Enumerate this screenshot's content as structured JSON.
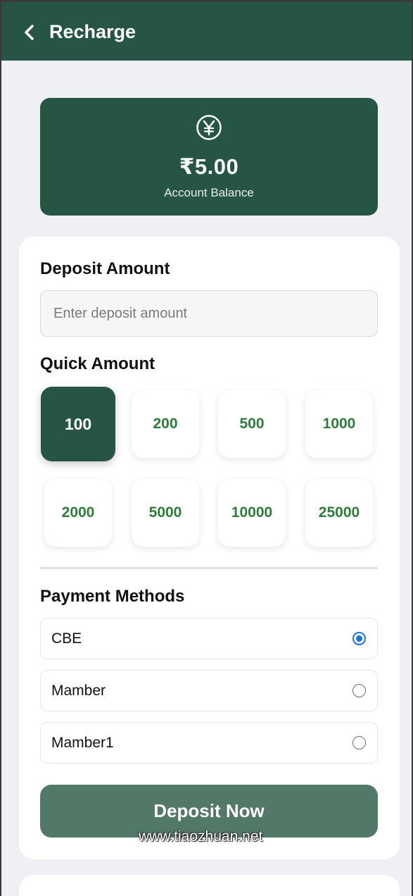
{
  "header": {
    "title": "Recharge",
    "back_icon": "chevron-left-icon"
  },
  "balance": {
    "icon": "yen-circle-icon",
    "amount": "₹5.00",
    "label": "Account Balance"
  },
  "deposit": {
    "title": "Deposit Amount",
    "placeholder": "Enter deposit amount",
    "value": ""
  },
  "quick": {
    "title": "Quick Amount",
    "amounts": [
      "100",
      "200",
      "500",
      "1000",
      "2000",
      "5000",
      "10000",
      "25000"
    ],
    "selected": "100"
  },
  "payment": {
    "title": "Payment Methods",
    "methods": [
      {
        "label": "CBE",
        "checked": true
      },
      {
        "label": "Mamber",
        "checked": false
      },
      {
        "label": "Mamber1",
        "checked": false
      }
    ]
  },
  "submit": {
    "label": "Deposit Now"
  },
  "watermark": "www.tiaozhuan.net",
  "colors": {
    "primary": "#275545",
    "accent_text": "#2e7d3a",
    "button_muted": "#527868",
    "radio": "#1a73d9",
    "background": "#eff0f4"
  }
}
